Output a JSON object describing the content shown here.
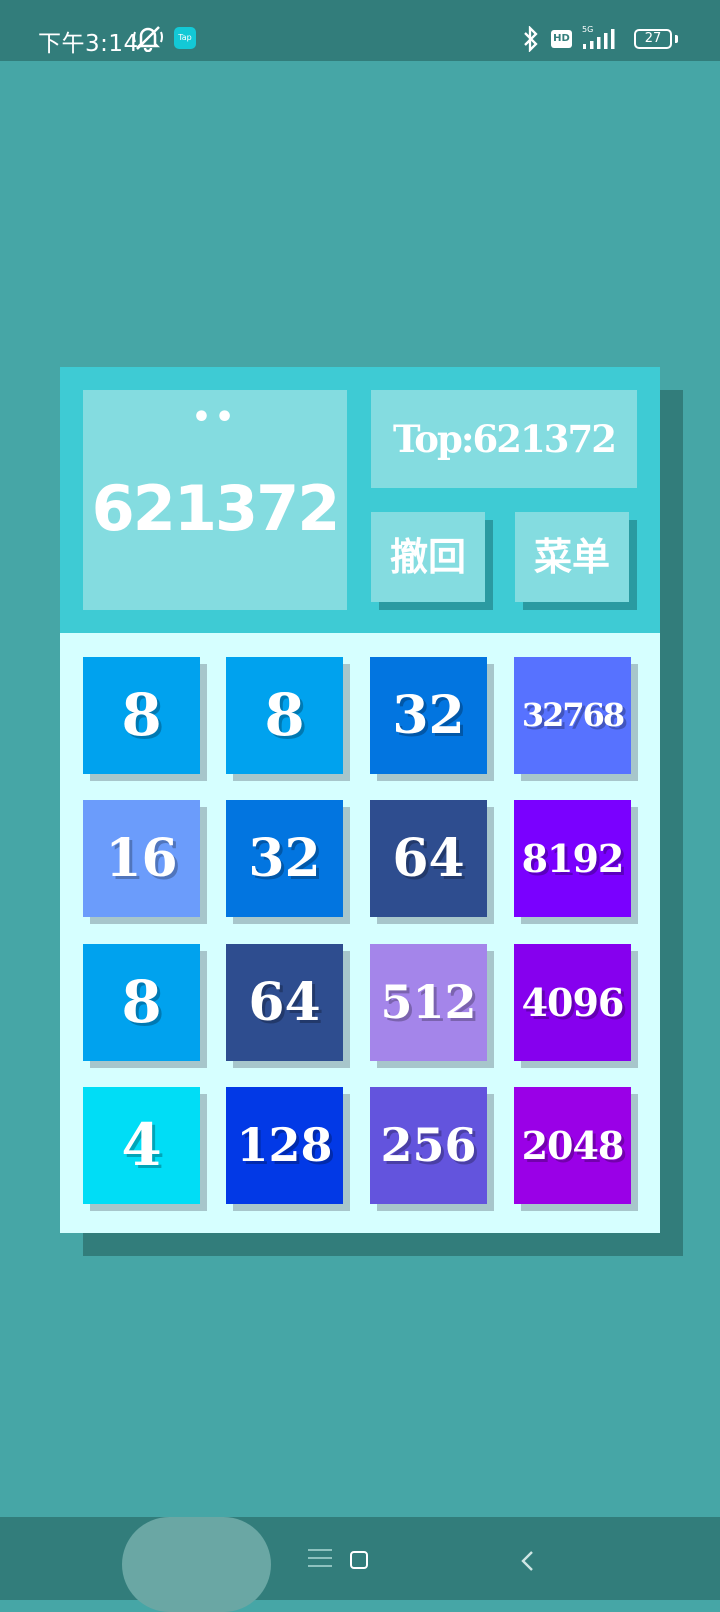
{
  "status_bar": {
    "time": "下午3:14",
    "app_badge": "Tap",
    "hd": "HD",
    "network": "5G",
    "battery": "27",
    "icons": [
      "silent-icon",
      "bluetooth-icon",
      "signal-icon",
      "battery-icon"
    ]
  },
  "score": {
    "dots": "••",
    "value": "621372"
  },
  "top_score": "Top:621372",
  "buttons": {
    "undo": "撤回",
    "menu": "菜单"
  },
  "board": [
    [
      {
        "value": "8",
        "color": "#00a2ee"
      },
      {
        "value": "8",
        "color": "#00a2ee"
      },
      {
        "value": "32",
        "color": "#0275e0"
      },
      {
        "value": "32768",
        "color": "#5772ff"
      }
    ],
    [
      {
        "value": "16",
        "color": "#6b9cfb"
      },
      {
        "value": "32",
        "color": "#0275e0"
      },
      {
        "value": "64",
        "color": "#2e4d8f"
      },
      {
        "value": "8192",
        "color": "#7a00ff"
      }
    ],
    [
      {
        "value": "8",
        "color": "#00a2ee"
      },
      {
        "value": "64",
        "color": "#2e4d8f"
      },
      {
        "value": "512",
        "color": "#a485ea"
      },
      {
        "value": "4096",
        "color": "#8600ee"
      }
    ],
    [
      {
        "value": "4",
        "color": "#00ddf6"
      },
      {
        "value": "128",
        "color": "#0239e6"
      },
      {
        "value": "256",
        "color": "#6354dd"
      },
      {
        "value": "2048",
        "color": "#9a00e7"
      }
    ]
  ],
  "colors": {
    "background": "#46a6a6",
    "bars": "#327d7b",
    "panel_top": "#3ecbd4",
    "panel_board": "#d6ffff",
    "box": "#84dce0"
  },
  "nav_bar": {
    "icons": [
      "menu-icon",
      "home-icon",
      "back-icon"
    ]
  }
}
